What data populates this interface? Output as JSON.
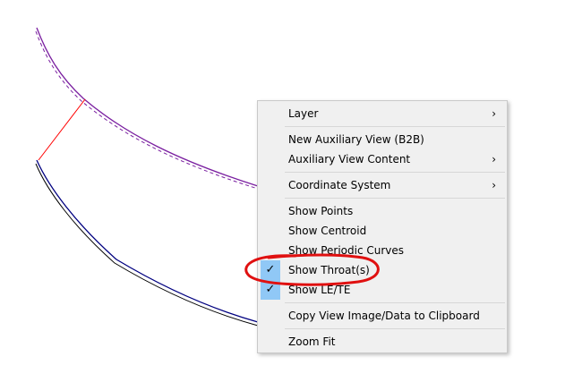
{
  "context_menu": {
    "items": [
      {
        "label": "Layer",
        "submenu": true
      },
      {
        "label": "New Auxiliary View (B2B)",
        "submenu": false
      },
      {
        "label": "Auxiliary View Content",
        "submenu": true
      },
      {
        "label": "Coordinate System",
        "submenu": true
      },
      {
        "label": "Show Points",
        "submenu": false
      },
      {
        "label": "Show Centroid",
        "submenu": false
      },
      {
        "label": "Show Periodic Curves",
        "submenu": false
      },
      {
        "label": "Show Throat(s)",
        "submenu": false,
        "checked": true
      },
      {
        "label": "Show LE/TE",
        "submenu": false,
        "checked": true
      },
      {
        "label": "Copy View Image/Data to Clipboard",
        "submenu": false
      },
      {
        "label": "Zoom Fit",
        "submenu": false
      }
    ],
    "submenu_glyph": "›",
    "check_glyph": "✓"
  },
  "colors": {
    "pressure_curve": "#7a1fa0",
    "suction_curve": "#000080",
    "throat_line": "#ff0000",
    "annotation": "#e01010",
    "check_highlight": "#90c8f6"
  },
  "icons": [
    "check-icon",
    "chevron-right-icon"
  ]
}
